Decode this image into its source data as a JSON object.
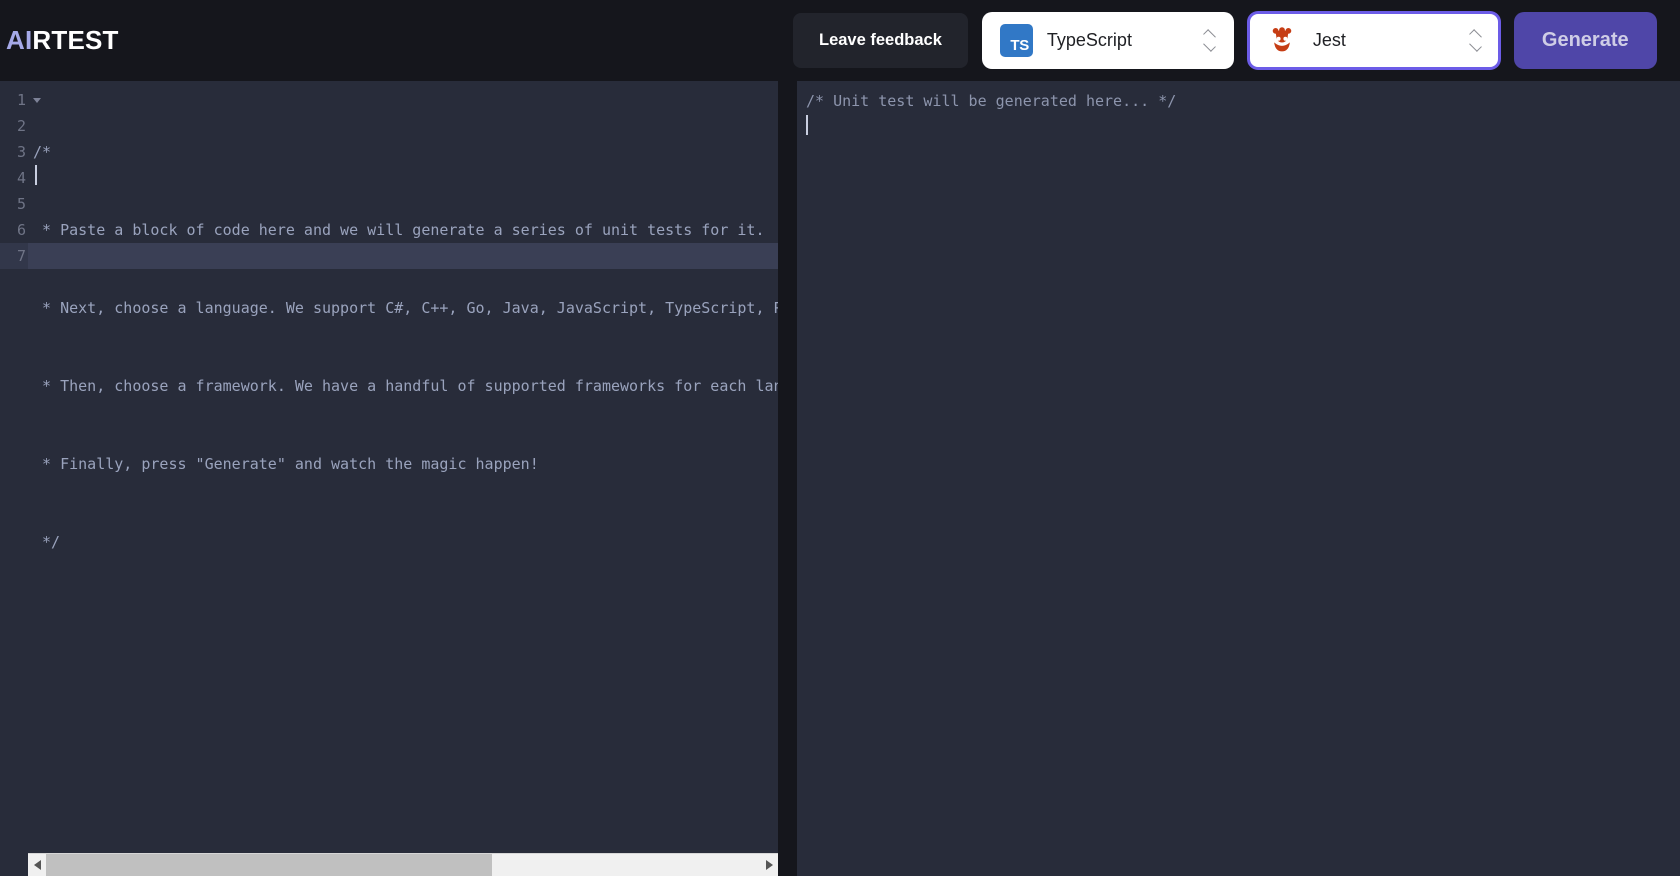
{
  "brand": {
    "prefix": "AI",
    "suffix": "RTEST"
  },
  "toolbar": {
    "feedback_label": "Leave feedback",
    "language_select": {
      "value": "TypeScript",
      "icon": "typescript-icon",
      "badge_text": "TS"
    },
    "framework_select": {
      "value": "Jest",
      "icon": "jest-icon",
      "focused": true
    },
    "generate_label": "Generate"
  },
  "colors": {
    "accent_purple": "#6c5ce7",
    "generate_bg": "#4f46a8",
    "editor_bg": "#282c3a",
    "app_bg": "#15161c",
    "ts_blue": "#3178c6",
    "jest_red": "#c63d14",
    "brand_ai": "#a5a9e8"
  },
  "left_editor": {
    "line_numbers": [
      "1",
      "2",
      "3",
      "4",
      "5",
      "6",
      "7"
    ],
    "lines": [
      "/*",
      " * Paste a block of code here and we will generate a series of unit tests for it.",
      " * Next, choose a language. We support C#, C++, Go, Java, JavaScript, TypeScript, Python, and more.",
      " * Then, choose a framework. We have a handful of supported frameworks for each language.",
      " * Finally, press \"Generate\" and watch the magic happen!",
      " */",
      ""
    ],
    "active_line": 7,
    "fold_marker_line": 1
  },
  "right_editor": {
    "placeholder_text": "/* Unit test will be generated here... */"
  },
  "scrollbar": {
    "left_arrow": "scroll-left-arrow",
    "right_arrow": "scroll-right-arrow",
    "thumb_fraction": "62.5%"
  }
}
